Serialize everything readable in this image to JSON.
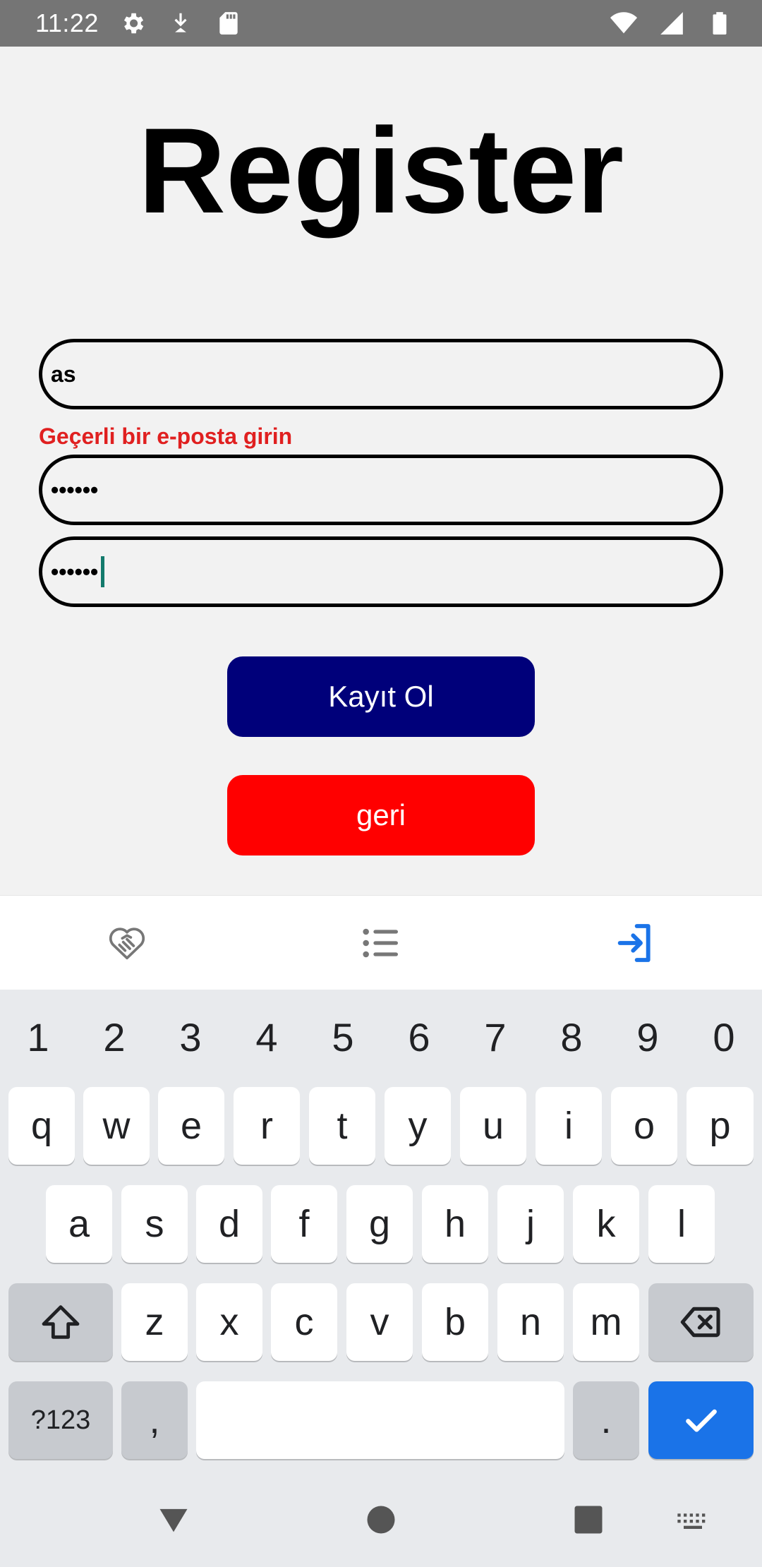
{
  "status_bar": {
    "time": "11:22",
    "left_icons": [
      "gear-icon",
      "download-icon",
      "sd-card-icon"
    ],
    "right_icons": [
      "wifi-icon",
      "signal-icon",
      "battery-icon"
    ]
  },
  "page": {
    "title": "Register",
    "email_value": "as",
    "email_error": "Geçerli bir e-posta girin",
    "password_value": "••••••",
    "password_confirm_value": "••••••",
    "register_button": "Kayıt Ol",
    "back_button": "geri"
  },
  "colors": {
    "register_button": "#00007a",
    "back_button": "#ff0000",
    "error": "#e02020",
    "active_nav": "#1a73e8"
  },
  "bottom_nav": [
    {
      "icon": "handshake-heart-icon",
      "active": false
    },
    {
      "icon": "list-icon",
      "active": false
    },
    {
      "icon": "login-icon",
      "active": true
    }
  ],
  "keyboard": {
    "numbers": [
      "1",
      "2",
      "3",
      "4",
      "5",
      "6",
      "7",
      "8",
      "9",
      "0"
    ],
    "row1": [
      "q",
      "w",
      "e",
      "r",
      "t",
      "y",
      "u",
      "i",
      "o",
      "p"
    ],
    "row2": [
      "a",
      "s",
      "d",
      "f",
      "g",
      "h",
      "j",
      "k",
      "l"
    ],
    "row3": [
      "z",
      "x",
      "c",
      "v",
      "b",
      "n",
      "m"
    ],
    "symbols_key": "?123",
    "comma_key": ",",
    "period_key": "."
  }
}
